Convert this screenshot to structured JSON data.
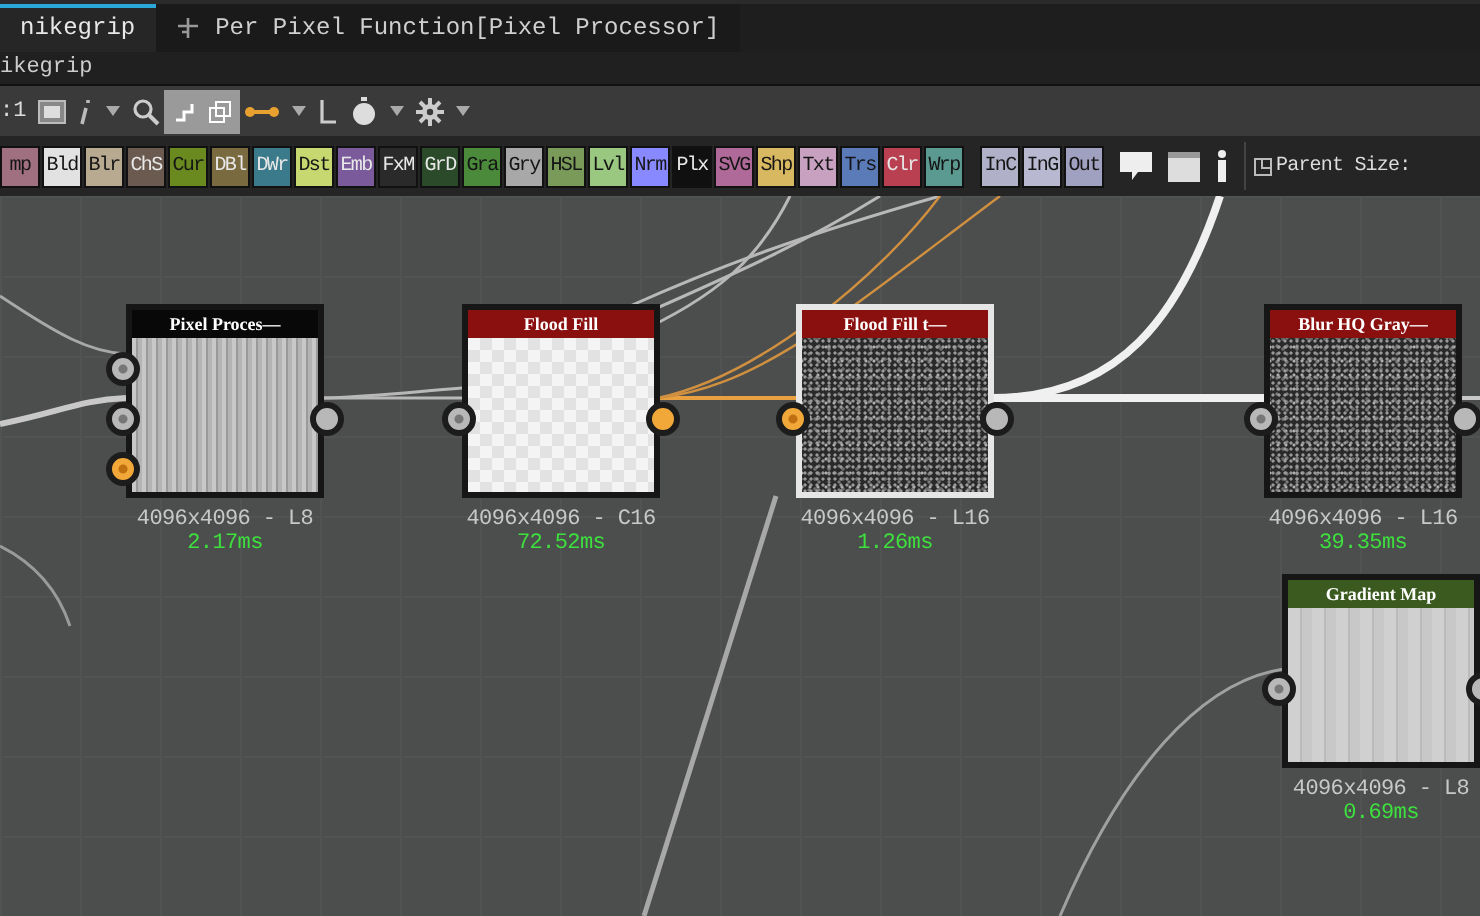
{
  "tabs": [
    {
      "label": "nikegrip",
      "selected": true,
      "kind": "graph"
    },
    {
      "label": "Per Pixel Function[Pixel Processor]",
      "selected": false,
      "kind": "function"
    }
  ],
  "breadcrumb": "ikegrip",
  "toolbar": {
    "zoom_label": ":1",
    "toggles": [
      {
        "selected": true
      },
      {
        "selected": true
      }
    ]
  },
  "atomic_groups": [
    [
      {
        "label": "mp",
        "color": "#a07080"
      },
      {
        "label": "Bld",
        "color": "#e2e2e2"
      },
      {
        "label": "Blr",
        "color": "#b8aa90"
      },
      {
        "label": "ChS",
        "color": "#6a5a50"
      },
      {
        "label": "Cur",
        "color": "#6a8a20"
      },
      {
        "label": "DBl",
        "color": "#7a6a40"
      },
      {
        "label": "DWr",
        "color": "#3a7a8a"
      },
      {
        "label": "Dst",
        "color": "#c8d870"
      },
      {
        "label": "Emb",
        "color": "#7a5a9a"
      },
      {
        "label": "FxM",
        "color": "#2a2a2a"
      },
      {
        "label": "GrD",
        "color": "#2a4a2a"
      },
      {
        "label": "Gra",
        "color": "#4a8a3a"
      },
      {
        "label": "Gry",
        "color": "#a8a8a8"
      },
      {
        "label": "HSL",
        "color": "#7a9a5a"
      },
      {
        "label": "Lvl",
        "color": "#9ac880"
      },
      {
        "label": "Nrm",
        "color": "#8888ff"
      },
      {
        "label": "Plx",
        "color": "#101010"
      },
      {
        "label": "SVG",
        "color": "#b06a9a"
      },
      {
        "label": "Shp",
        "color": "#d8b860"
      },
      {
        "label": "Txt",
        "color": "#c8a0c0"
      },
      {
        "label": "Trs",
        "color": "#5a7ab8"
      },
      {
        "label": "Clr",
        "color": "#b84050"
      },
      {
        "label": "Wrp",
        "color": "#5a9a90"
      }
    ],
    [
      {
        "label": "InC",
        "color": "#b0b0c8"
      },
      {
        "label": "InG",
        "color": "#b8b8d0"
      },
      {
        "label": "Out",
        "color": "#a0a0c0"
      }
    ]
  ],
  "parent_size": {
    "label": "Parent Size:"
  },
  "nodes": [
    {
      "title": "Pixel Proces—",
      "color": "#080808",
      "kind": "stripes",
      "selected": false,
      "resolution": "4096x4096 - L8",
      "time": "2.17ms",
      "inputs": [
        {
          "highlighted": false
        },
        {
          "highlighted": false
        },
        {
          "highlighted": true
        }
      ],
      "outputs": [
        {
          "highlighted": false
        }
      ]
    },
    {
      "title": "Flood Fill",
      "color": "#8a1010",
      "kind": "checker",
      "selected": false,
      "resolution": "4096x4096 - C16",
      "time": "72.52ms",
      "inputs": [
        {
          "highlighted": false
        }
      ],
      "outputs": [
        {
          "highlighted": true
        }
      ]
    },
    {
      "title": "Flood Fill t—",
      "color": "#8a1010",
      "kind": "noise",
      "selected": true,
      "resolution": "4096x4096 - L16",
      "time": "1.26ms",
      "inputs": [
        {
          "highlighted": true
        }
      ],
      "outputs": [
        {
          "highlighted": false
        }
      ]
    },
    {
      "title": "Blur HQ Gray—",
      "color": "#8a1010",
      "kind": "noise",
      "selected": false,
      "resolution": "4096x4096 - L16",
      "time": "39.35ms",
      "inputs": [
        {
          "highlighted": false
        }
      ],
      "outputs": [
        {
          "highlighted": false
        }
      ]
    },
    {
      "title": "Gradient Map",
      "color": "#3a5a20",
      "kind": "light-stripes",
      "selected": false,
      "resolution": "4096x4096 - L8",
      "time": "0.69ms",
      "inputs": [
        {
          "highlighted": false
        }
      ],
      "outputs": [
        {
          "highlighted": false
        }
      ]
    }
  ]
}
